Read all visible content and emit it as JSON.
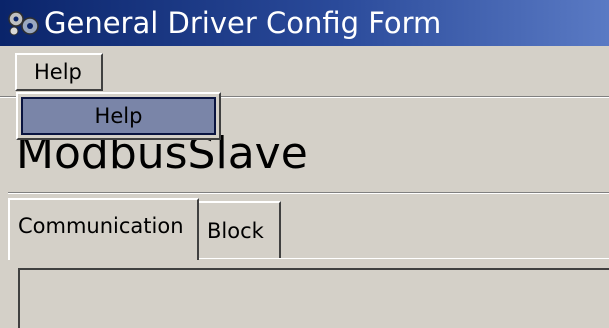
{
  "window": {
    "title": "General Driver Config Form",
    "icon": "gears-icon"
  },
  "menubar": {
    "items": [
      {
        "label": "Help"
      }
    ]
  },
  "help_menu": {
    "items": [
      {
        "label": "Help",
        "highlighted": true
      }
    ]
  },
  "main": {
    "heading": "ModbusSlave",
    "tabs": [
      {
        "label": "Communication",
        "active": true
      },
      {
        "label": "Block",
        "active": false
      }
    ]
  },
  "colors": {
    "titlebar_start": "#0a246a",
    "titlebar_end": "#5a7ac4",
    "window_bg": "#d4d0c8",
    "menu_highlight": "#7a85a8"
  }
}
